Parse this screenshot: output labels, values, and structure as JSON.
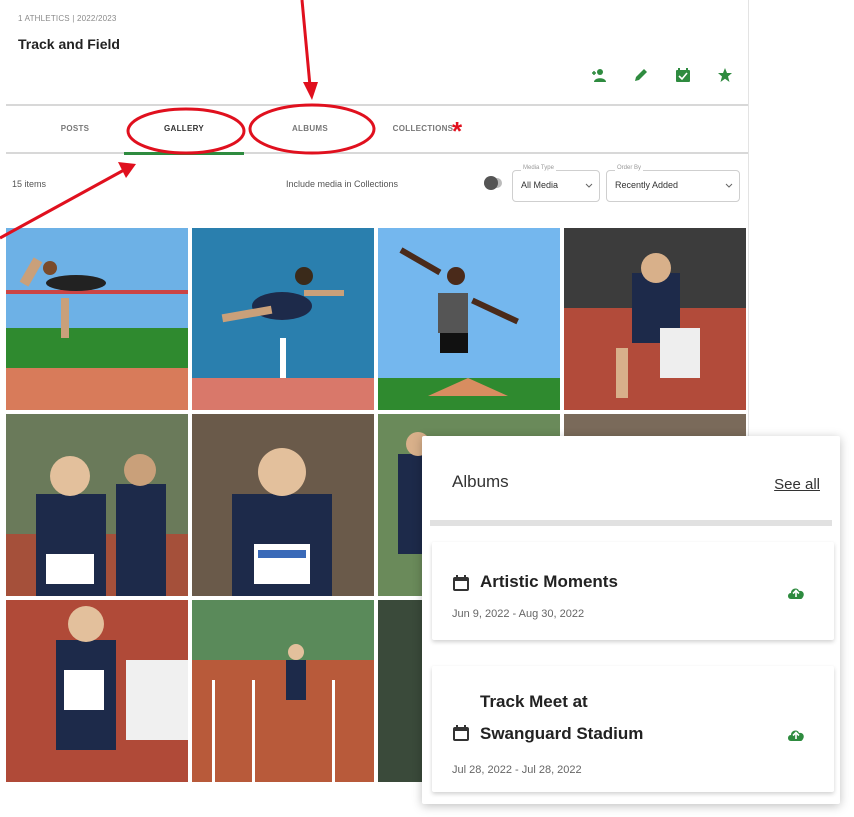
{
  "header": {
    "breadcrumb": "1 ATHLETICS | 2022/2023",
    "title": "Track and Field",
    "action_icons": [
      "user-plus-icon",
      "pencil-icon",
      "calendar-check-icon",
      "star-icon"
    ]
  },
  "tabs": [
    {
      "label": "POSTS",
      "active": false
    },
    {
      "label": "GALLERY",
      "active": true
    },
    {
      "label": "ALBUMS",
      "active": false
    },
    {
      "label": "COLLECTIONS",
      "active": false
    }
  ],
  "filters": {
    "items_count": "15 items",
    "include_label": "Include media in Collections",
    "media_type": {
      "label": "Media Type",
      "value": "All Media"
    },
    "order_by": {
      "label": "Order By",
      "value": "Recently Added"
    }
  },
  "albums_panel": {
    "title": "Albums",
    "see_all": "See all",
    "albums": [
      {
        "name": "Artistic Moments",
        "dates": "Jun 9, 2022 - Aug 30, 2022"
      },
      {
        "name_line1": "Track Meet at",
        "name_line2": "Swanguard Stadium",
        "dates": "Jul 28, 2022 - Jul 28, 2022"
      }
    ]
  },
  "annotation": {
    "asterisk": "*"
  },
  "colors": {
    "accent_green": "#2e8b3f",
    "annotation_red": "#e0101e"
  }
}
